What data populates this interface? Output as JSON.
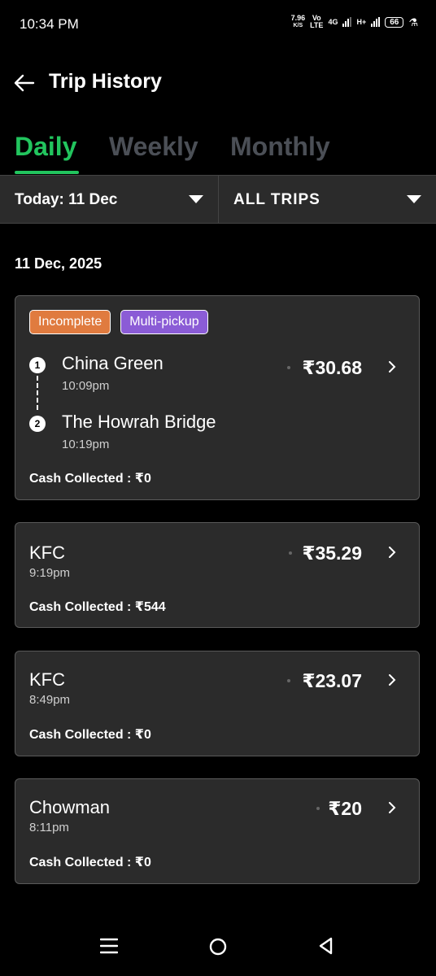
{
  "status": {
    "time": "10:34 PM",
    "speed_value": "7.96",
    "speed_unit": "K/S",
    "volte_top": "Vo",
    "volte_bottom": "LTE",
    "net1": "4G",
    "net2": "H+",
    "battery": "66"
  },
  "header": {
    "title": "Trip History"
  },
  "tabs": [
    {
      "label": "Daily",
      "active": true
    },
    {
      "label": "Weekly",
      "active": false
    },
    {
      "label": "Monthly",
      "active": false
    }
  ],
  "filters": {
    "date": "Today: 11 Dec",
    "trips": "ALL TRIPS"
  },
  "section": {
    "date_heading": "11 Dec, 2025"
  },
  "trips": [
    {
      "badges": [
        "Incomplete",
        "Multi-pickup"
      ],
      "stops": [
        {
          "num": "1",
          "name": "China Green",
          "time": "10:09pm"
        },
        {
          "num": "2",
          "name": "The Howrah Bridge",
          "time": "10:19pm"
        }
      ],
      "fare": "₹30.68",
      "cash": "Cash Collected : ₹0"
    },
    {
      "place": "KFC",
      "time": "9:19pm",
      "fare": "₹35.29",
      "cash": "Cash Collected : ₹544"
    },
    {
      "place": "KFC",
      "time": "8:49pm",
      "fare": "₹23.07",
      "cash": "Cash Collected : ₹0"
    },
    {
      "place": "Chowman",
      "time": "8:11pm",
      "fare": "₹20",
      "cash": "Cash Collected : ₹0"
    }
  ],
  "colors": {
    "accent_green": "#22c55e",
    "badge_incomplete": "#e07b3f",
    "badge_multipickup": "#8b5cd6",
    "card_bg": "#2b2b2b"
  },
  "icons": {
    "back": "arrow-left-icon",
    "caret": "caret-down-icon",
    "chevron": "chevron-right-icon",
    "nav_recents": "menu-icon",
    "nav_home": "circle-icon",
    "nav_back": "triangle-back-icon"
  }
}
